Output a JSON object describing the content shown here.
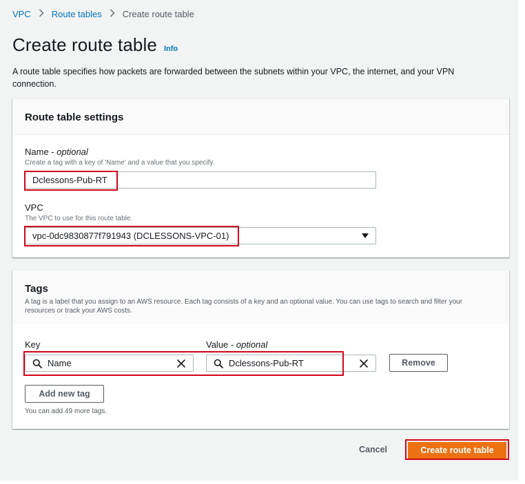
{
  "breadcrumb": {
    "items": [
      "VPC",
      "Route tables"
    ],
    "current": "Create route table"
  },
  "header": {
    "title": "Create route table",
    "info_link": "Info",
    "description": "A route table specifies how packets are forwarded between the subnets within your VPC, the internet, and your VPN connection."
  },
  "settings": {
    "title": "Route table settings",
    "name": {
      "label": "Name -",
      "label_optional": "optional",
      "description": "Create a tag with a key of 'Name' and a value that you specify.",
      "value": "Dclessons-Pub-RT"
    },
    "vpc": {
      "label": "VPC",
      "description": "The VPC to use for this route table.",
      "selected": "vpc-0dc9830877f791943 (DCLESSONS-VPC-01)"
    }
  },
  "tags": {
    "title": "Tags",
    "description": "A tag is a label that you assign to an AWS resource. Each tag consists of a key and an optional value. You can use tags to search and filter your resources or track your AWS costs.",
    "key_header": "Key",
    "value_header": "Value -",
    "value_header_optional": "optional",
    "rows": [
      {
        "key": "Name",
        "value": "Dclessons-Pub-RT"
      }
    ],
    "remove_label": "Remove",
    "add_label": "Add new tag",
    "hint": "You can add 49 more tags."
  },
  "footer": {
    "cancel_label": "Cancel",
    "create_label": "Create route table"
  },
  "colors": {
    "primary": "#ec7211",
    "link": "#0073bb",
    "highlight": "#d0021b"
  }
}
